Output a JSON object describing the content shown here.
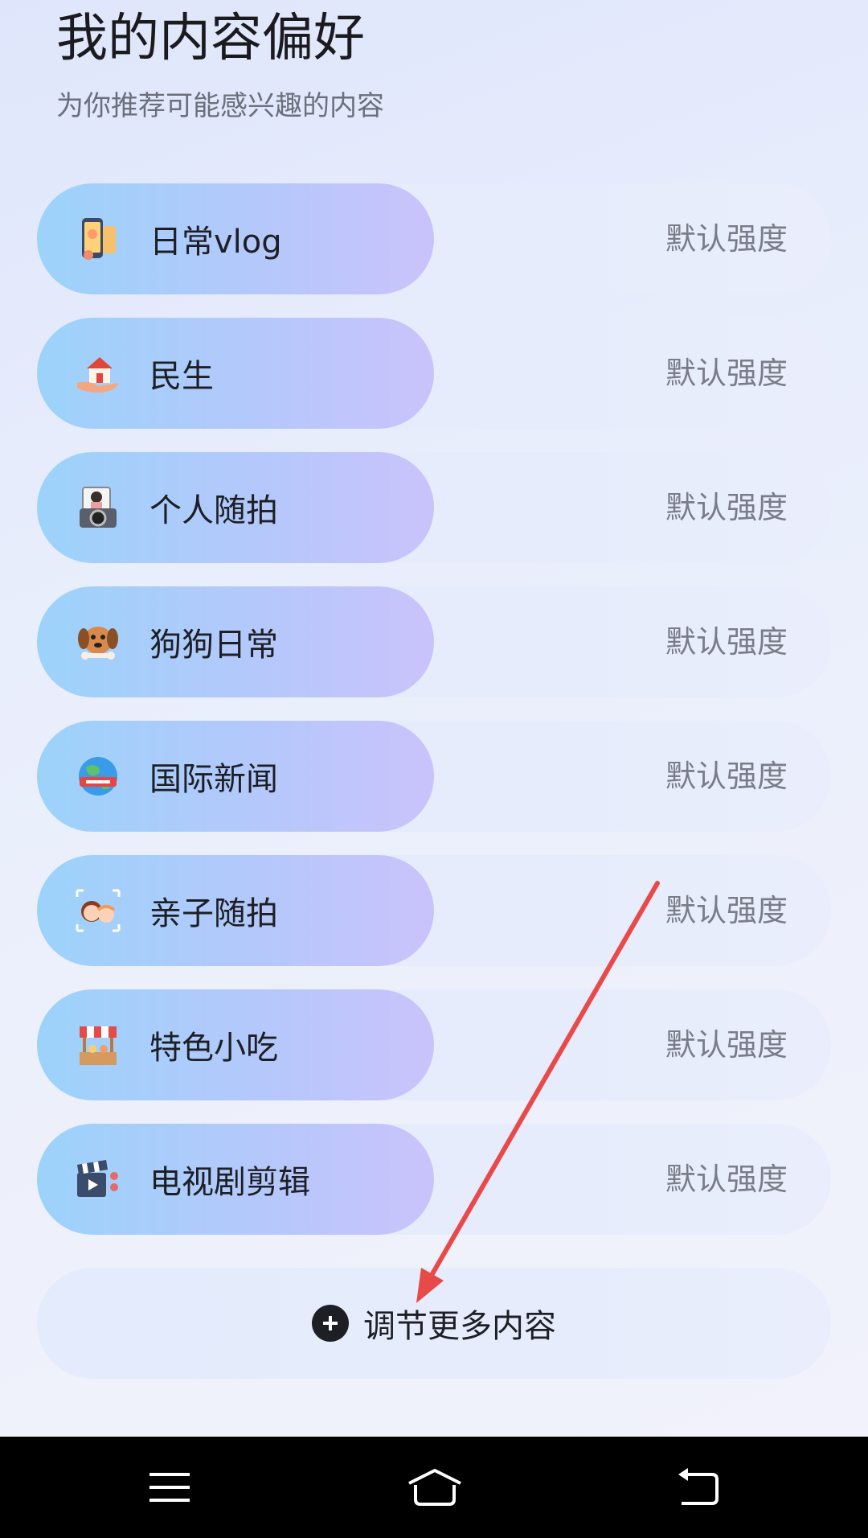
{
  "header": {
    "title": "我的内容偏好",
    "subtitle": "为你推荐可能感兴趣的内容"
  },
  "preferences": [
    {
      "label": "日常vlog",
      "strength": "默认强度",
      "icon": "phone-selfie-icon"
    },
    {
      "label": "民生",
      "strength": "默认强度",
      "icon": "house-in-hand-icon"
    },
    {
      "label": "个人随拍",
      "strength": "默认强度",
      "icon": "camera-portrait-icon"
    },
    {
      "label": "狗狗日常",
      "strength": "默认强度",
      "icon": "dog-icon"
    },
    {
      "label": "国际新闻",
      "strength": "默认强度",
      "icon": "globe-news-icon"
    },
    {
      "label": "亲子随拍",
      "strength": "默认强度",
      "icon": "parent-child-icon"
    },
    {
      "label": "特色小吃",
      "strength": "默认强度",
      "icon": "food-stall-icon"
    },
    {
      "label": "电视剧剪辑",
      "strength": "默认强度",
      "icon": "clapperboard-icon"
    }
  ],
  "add_more": {
    "label": "调节更多内容",
    "icon": "plus-circle-icon"
  },
  "colors": {
    "pill_start": "#9cd3fb",
    "pill_end": "#cac3fb",
    "arrow": "#e84a4a",
    "nav_bg": "#000000"
  },
  "navbar": {
    "buttons": [
      "menu-icon",
      "home-icon",
      "back-icon"
    ]
  }
}
